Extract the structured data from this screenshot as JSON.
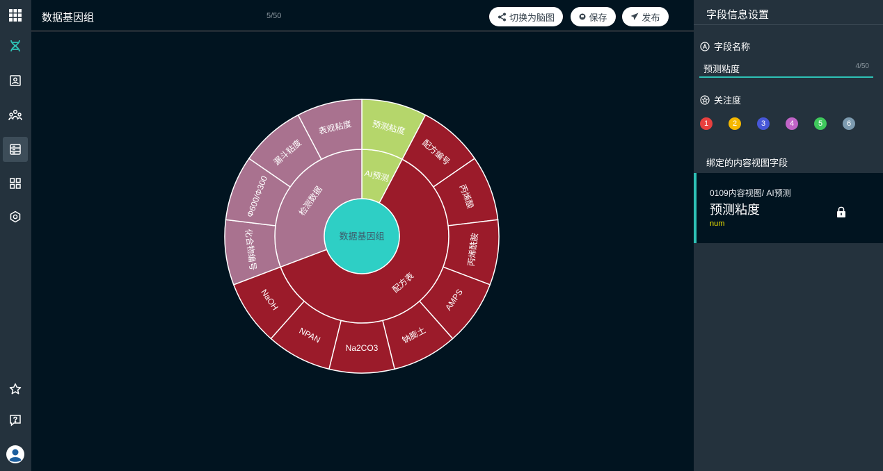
{
  "header": {
    "title": "数据基因组",
    "counter": "5/50",
    "switch_label": "切换为脑图",
    "save_label": "保存",
    "publish_label": "发布"
  },
  "sidebar": {
    "items": [
      {
        "name": "apps-grid-icon"
      },
      {
        "name": "dna-icon"
      },
      {
        "name": "contact-folder-icon"
      },
      {
        "name": "team-icon"
      },
      {
        "name": "storage-icon",
        "active": true
      },
      {
        "name": "dashboard-icon"
      },
      {
        "name": "settings-icon"
      },
      {
        "name": "star-icon"
      },
      {
        "name": "help-icon"
      },
      {
        "name": "user-avatar-icon"
      }
    ]
  },
  "chart_data": {
    "type": "sunburst",
    "center": {
      "label": "数据基因组",
      "color": "#2ecfc5"
    },
    "children": [
      {
        "label": "AI预测",
        "color": "#b5d66b",
        "children": [
          {
            "label": "预测粘度",
            "color": "#b5d66b"
          }
        ]
      },
      {
        "label": "配方表",
        "color": "#9b1b2a",
        "children": [
          {
            "label": "配方编号",
            "color": "#9b1b2a"
          },
          {
            "label": "丙烯酸",
            "color": "#9b1b2a"
          },
          {
            "label": "丙烯酰胺",
            "color": "#9b1b2a"
          },
          {
            "label": "AMPS",
            "color": "#9b1b2a"
          },
          {
            "label": "钠膨土",
            "color": "#9b1b2a"
          },
          {
            "label": "Na2CO3",
            "color": "#9b1b2a"
          },
          {
            "label": "NPAN",
            "color": "#9b1b2a"
          },
          {
            "label": "NaOH",
            "color": "#9b1b2a"
          }
        ]
      },
      {
        "label": "检测数据",
        "color": "#a9728f",
        "children": [
          {
            "label": "化合物编号",
            "color": "#a9728f"
          },
          {
            "label": "Φ600/Φ300",
            "color": "#a9728f"
          },
          {
            "label": "漏斗粘度",
            "color": "#a9728f"
          },
          {
            "label": "表观粘度",
            "color": "#a9728f"
          }
        ]
      }
    ]
  },
  "panel": {
    "title": "字段信息设置",
    "field_name_label": "字段名称",
    "field_name_value": "预测粘度",
    "field_name_count": "4/50",
    "attention_label": "关注度",
    "attention_levels": [
      {
        "label": "1",
        "color": "#e8403f"
      },
      {
        "label": "2",
        "color": "#f5b800"
      },
      {
        "label": "3",
        "color": "#4757d8"
      },
      {
        "label": "4",
        "color": "#c164c7"
      },
      {
        "label": "5",
        "color": "#3fc95c"
      },
      {
        "label": "6",
        "color": "#7d9bb0"
      }
    ],
    "bound_title": "绑定的内容视图字段",
    "card": {
      "path": "0109内容视图/ AI预测",
      "name": "预测粘度",
      "type": "num"
    }
  }
}
